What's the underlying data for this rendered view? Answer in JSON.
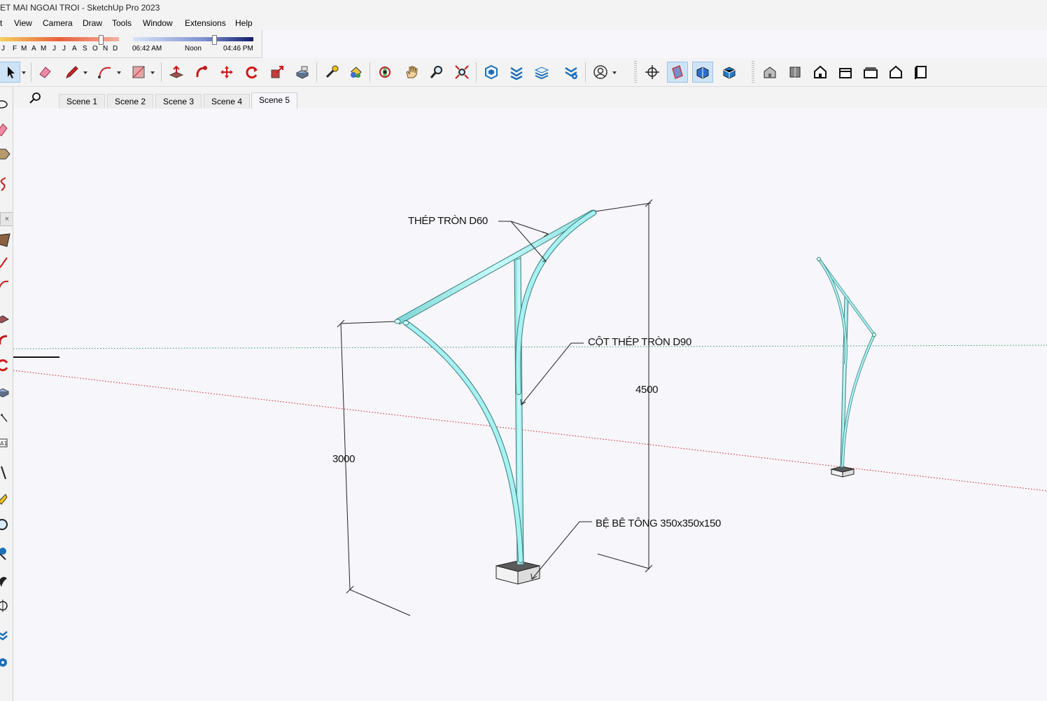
{
  "window": {
    "title": "ET MAI NGOAI TROI - SketchUp Pro 2023"
  },
  "menu": [
    "t",
    "View",
    "Camera",
    "Draw",
    "Tools",
    "Window",
    "Extensions",
    "Help"
  ],
  "shadows": {
    "months": [
      "J",
      "F",
      "M",
      "A",
      "M",
      "J",
      "J",
      "A",
      "S",
      "O",
      "N",
      "D"
    ],
    "time_start": "06:42 AM",
    "time_mid": "Noon",
    "time_end": "04:46 PM",
    "date_level": 0.82,
    "time_level": 0.67
  },
  "toolbar": {
    "icons": [
      "select-icon",
      "eraser-icon",
      "pencil-icon",
      "arc-icon",
      "rectangle-icon",
      "push-pull-icon",
      "follow-me-icon",
      "move-icon",
      "rotate-icon",
      "scale-icon",
      "offset-icon",
      "tape-measure-icon",
      "paint-bucket-icon",
      "orbit-icon",
      "pan-icon",
      "zoom-icon",
      "zoom-extents-icon",
      "warehouse-icon",
      "extension-warehouse-icon",
      "layout-icon",
      "extension-manager-icon",
      "account-icon",
      "position-camera-icon",
      "section-plane-icon",
      "display-section-icon",
      "section-fill-icon",
      "iso-view-icon",
      "top-view-icon",
      "front-view-icon",
      "right-view-icon",
      "back-view-icon",
      "left-view-icon",
      "bottom-view-icon"
    ]
  },
  "scenes": {
    "tabs": [
      "Scene 1",
      "Scene 2",
      "Scene 3",
      "Scene 4",
      "Scene 5"
    ],
    "active": 4
  },
  "model": {
    "label_beam": "THÉP TRÒN D60",
    "label_column": "CỘT THÉP TRÒN D90",
    "label_base": "BỆ BÊ TÔNG 350x350x150",
    "dim_height_left": "3000",
    "dim_height_right": "4500"
  },
  "colors": {
    "steel": "#a6f2f2",
    "steel_edge": "#4b8c8c",
    "background": "#f7f6fb"
  }
}
